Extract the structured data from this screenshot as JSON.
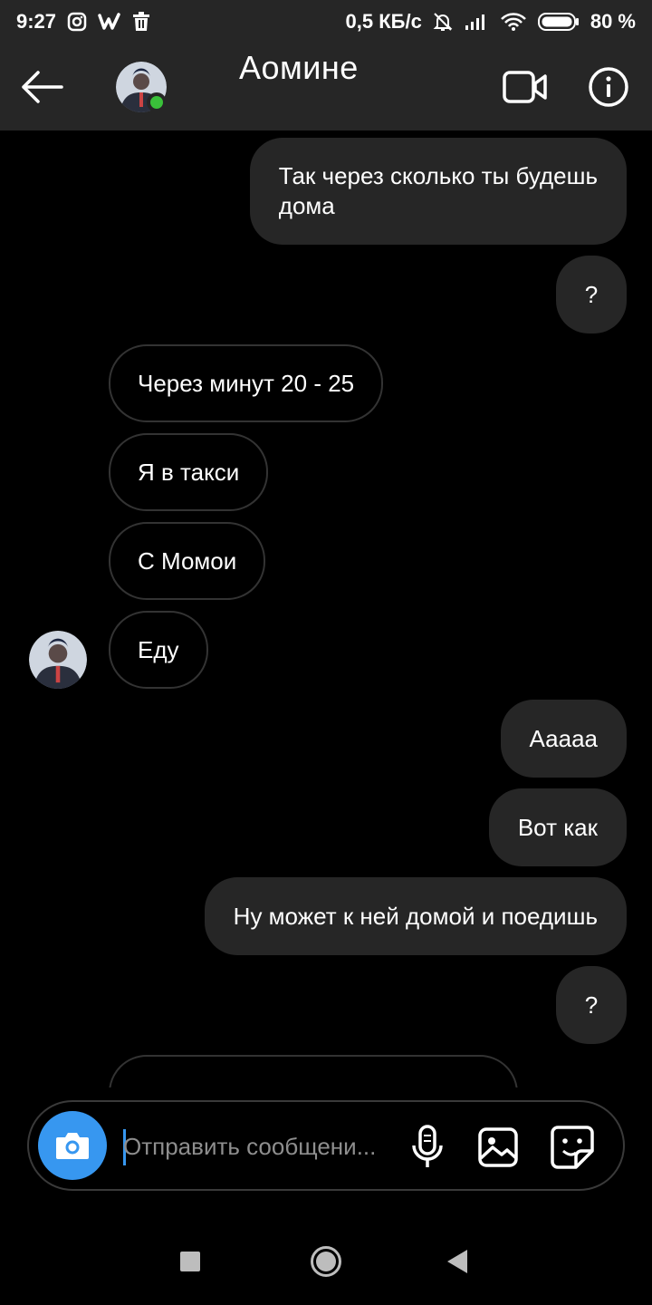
{
  "status_bar": {
    "time": "9:27",
    "network_speed": "0,5 КБ/с",
    "battery_percent": "80 %",
    "battery_level": 0.8,
    "icons": [
      "instagram-icon",
      "w-app-icon",
      "trash-icon",
      "mute-bell-icon",
      "signal-icon",
      "wifi-icon",
      "battery-icon"
    ]
  },
  "header": {
    "contact_name": "Аомине",
    "online": true,
    "back_icon": "back-arrow-icon",
    "video_icon": "video-camera-icon",
    "info_icon": "info-icon"
  },
  "messages": [
    {
      "direction": "outgoing",
      "lines": [
        "Так через сколько ты будешь",
        "дома"
      ]
    },
    {
      "direction": "outgoing",
      "lines": [
        "?"
      ]
    },
    {
      "direction": "incoming",
      "lines": [
        "Через минут 20 - 25"
      ]
    },
    {
      "direction": "incoming",
      "lines": [
        "Я в такси"
      ]
    },
    {
      "direction": "incoming",
      "lines": [
        "С Момои"
      ]
    },
    {
      "direction": "incoming",
      "lines": [
        "Еду"
      ]
    },
    {
      "direction": "outgoing",
      "lines": [
        "Ааааа"
      ]
    },
    {
      "direction": "outgoing",
      "lines": [
        "Вот как"
      ]
    },
    {
      "direction": "outgoing",
      "lines": [
        "Ну может к ней домой и поедишь"
      ]
    },
    {
      "direction": "outgoing",
      "lines": [
        "?"
      ]
    },
    {
      "direction": "incoming",
      "lines": []
    }
  ],
  "composer": {
    "placeholder": "Отправить сообщени...",
    "value": "",
    "icons": [
      "camera-icon",
      "microphone-icon",
      "gallery-icon",
      "sticker-icon"
    ]
  },
  "nav_bar": {
    "icons": [
      "recents-square-icon",
      "home-circle-icon",
      "back-triangle-icon"
    ]
  },
  "colors": {
    "background": "#000000",
    "bar": "#262626",
    "outgoing_bubble": "#262626",
    "incoming_border": "#333333",
    "accent": "#3797f0",
    "online": "#3ac13a"
  }
}
